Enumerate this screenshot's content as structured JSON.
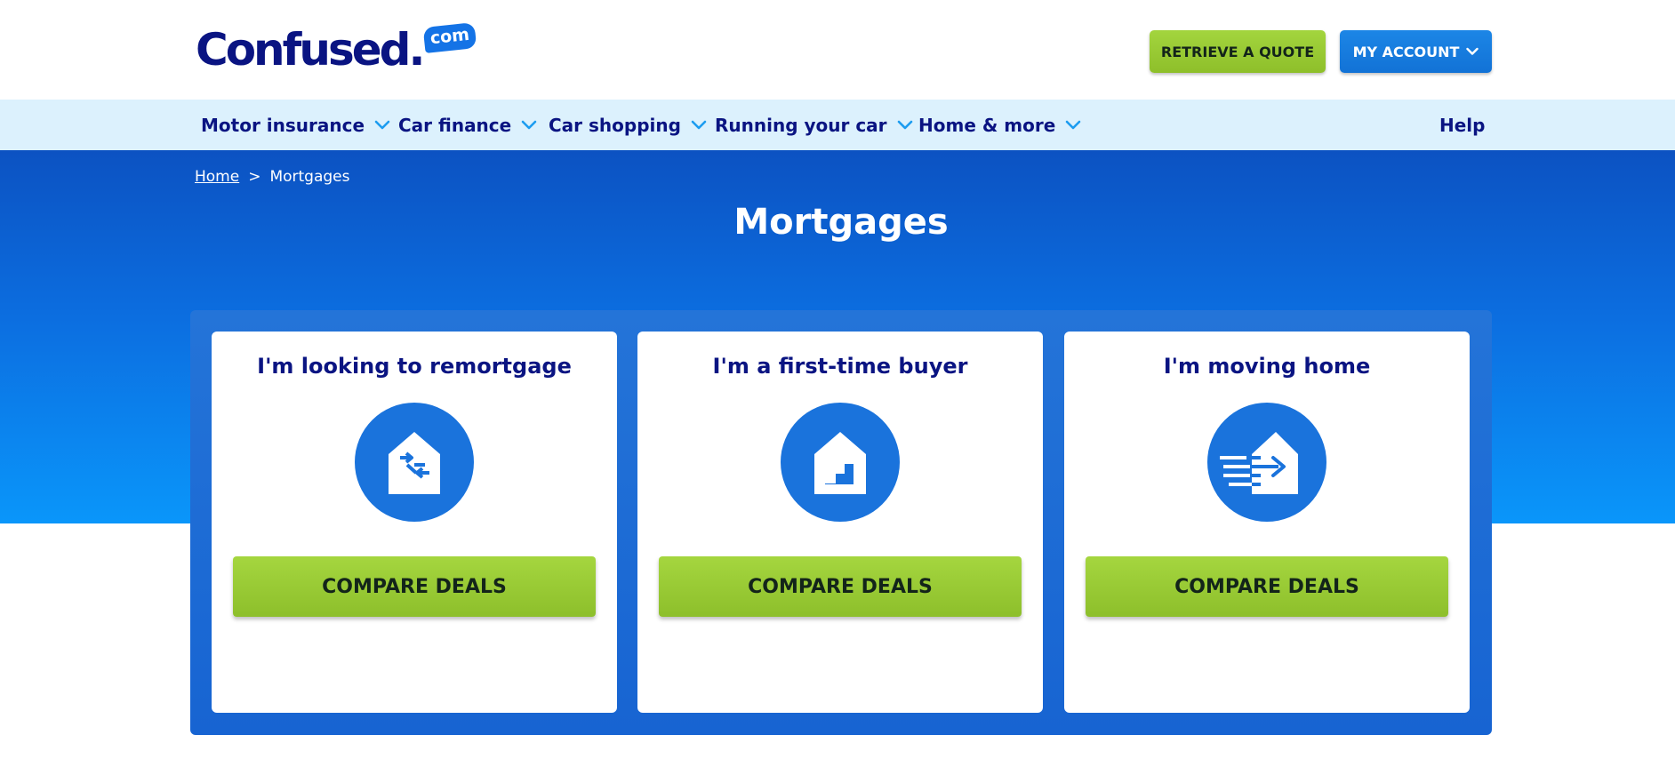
{
  "header": {
    "logo_text": "Confused.",
    "logo_badge": "com",
    "retrieve_label": "RETRIEVE A QUOTE",
    "account_label": "MY ACCOUNT"
  },
  "nav": {
    "items": [
      {
        "label": "Motor insurance"
      },
      {
        "label": "Car finance"
      },
      {
        "label": "Car shopping"
      },
      {
        "label": "Running your car"
      },
      {
        "label": "Home & more"
      }
    ],
    "help_label": "Help"
  },
  "breadcrumb": {
    "home": "Home",
    "separator": ">",
    "current": "Mortgages"
  },
  "page": {
    "title": "Mortgages"
  },
  "cards": [
    {
      "title": "I'm looking to remortgage",
      "icon": "house-exchange-icon",
      "button": "COMPARE DEALS"
    },
    {
      "title": "I'm a first-time buyer",
      "icon": "house-stairs-icon",
      "button": "COMPARE DEALS"
    },
    {
      "title": "I'm moving home",
      "icon": "house-moving-icon",
      "button": "COMPARE DEALS"
    }
  ],
  "colors": {
    "brand_navy": "#0a1482",
    "brand_blue": "#1473e6",
    "cta_green": "#9bcb36",
    "nav_bg": "#dcf1fd"
  }
}
